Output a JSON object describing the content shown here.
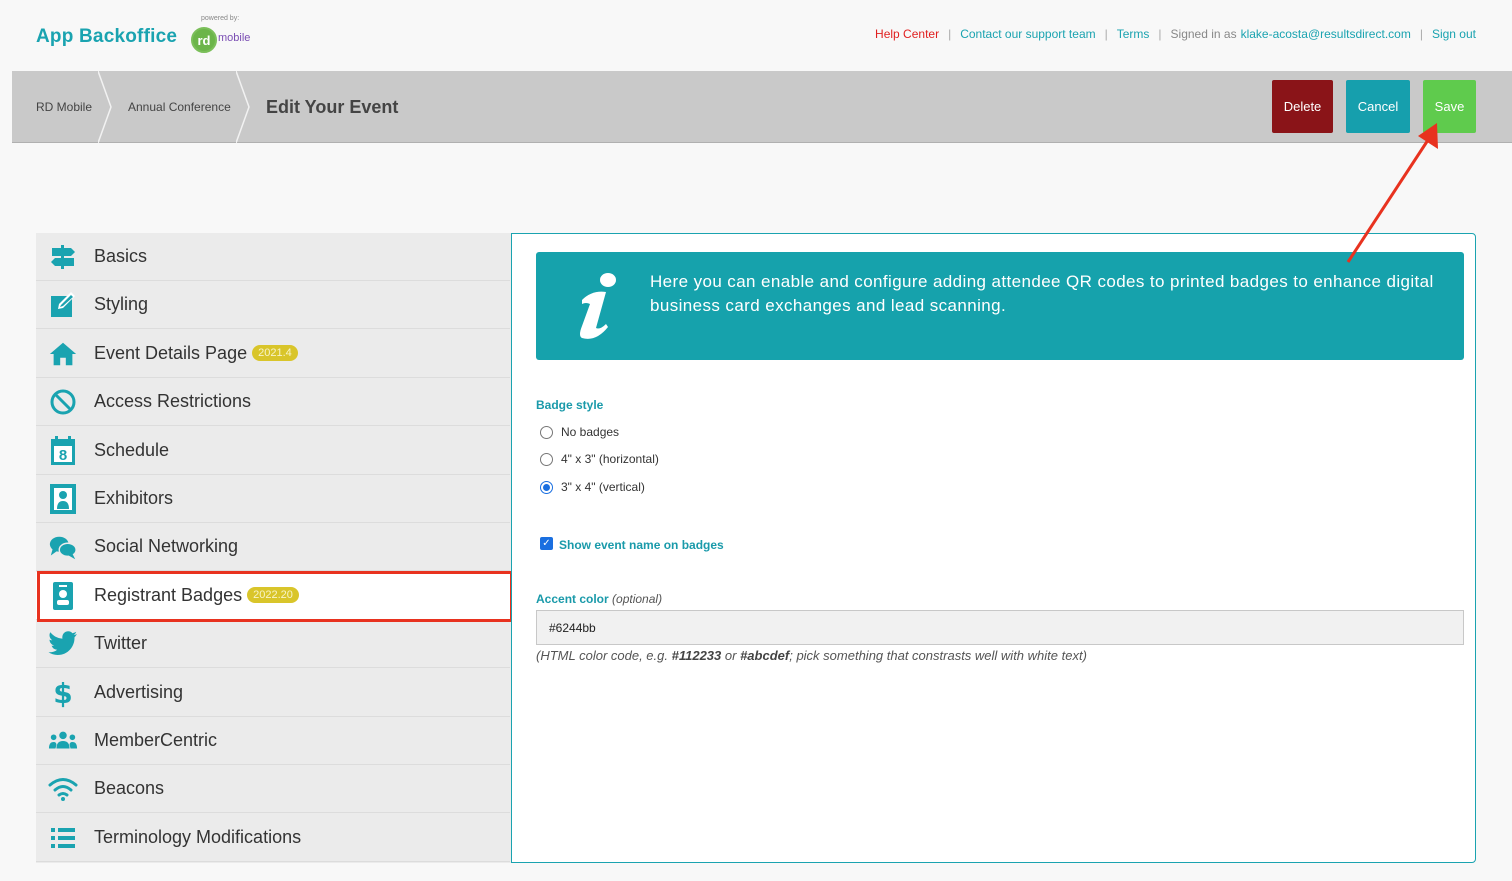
{
  "header": {
    "logo_text": "App Backoffice",
    "powered_by": "powered by:",
    "rd_text": "rd",
    "mobile_text": "mobile",
    "links": {
      "help": "Help Center",
      "contact": "Contact our support team",
      "terms": "Terms",
      "signed_in_prefix": "Signed in as",
      "email": "klake-acosta@resultsdirect.com",
      "sign_out": "Sign out"
    },
    "separator": "|"
  },
  "breadcrumb": {
    "items": [
      "RD Mobile",
      "Annual Conference"
    ],
    "current": "Edit Your Event"
  },
  "actions": {
    "delete": "Delete",
    "cancel": "Cancel",
    "save": "Save"
  },
  "sidebar": {
    "items": [
      {
        "label": "Basics",
        "icon": "signpost-icon"
      },
      {
        "label": "Styling",
        "icon": "edit-icon"
      },
      {
        "label": "Event Details Page",
        "icon": "home-icon",
        "badge": "2021.4"
      },
      {
        "label": "Access Restrictions",
        "icon": "ban-icon"
      },
      {
        "label": "Schedule",
        "icon": "calendar-icon",
        "calendar_day": "8"
      },
      {
        "label": "Exhibitors",
        "icon": "portrait-icon"
      },
      {
        "label": "Social Networking",
        "icon": "chat-icon"
      },
      {
        "label": "Registrant Badges",
        "icon": "id-badge-icon",
        "badge": "2022.20",
        "active": true
      },
      {
        "label": "Twitter",
        "icon": "twitter-icon"
      },
      {
        "label": "Advertising",
        "icon": "dollar-icon"
      },
      {
        "label": "MemberCentric",
        "icon": "users-icon"
      },
      {
        "label": "Beacons",
        "icon": "wifi-icon"
      },
      {
        "label": "Terminology Modifications",
        "icon": "list-icon"
      }
    ]
  },
  "main": {
    "info_text": "Here you can enable and configure adding attendee QR codes to printed badges to enhance digital business card exchanges and lead scanning.",
    "badge_style": {
      "label": "Badge style",
      "options": [
        "No badges",
        "4\" x 3\" (horizontal)",
        "3\" x 4\" (vertical)"
      ],
      "selected_index": 2
    },
    "show_event_name": {
      "label": "Show event name on badges",
      "checked": true
    },
    "accent_color": {
      "label": "Accent color",
      "optional": "(optional)",
      "value": "#6244bb",
      "hint_pre": "(HTML color code, e.g.",
      "hint_ex1": "#112233",
      "hint_or": "or",
      "hint_ex2": "#abcdef",
      "hint_post": "; pick something that constrasts well with white text)"
    }
  },
  "colors": {
    "accent": "#1aa3b0",
    "delete": "#8a1418",
    "save": "#5fcb4d",
    "annotation": "#e8321f"
  }
}
